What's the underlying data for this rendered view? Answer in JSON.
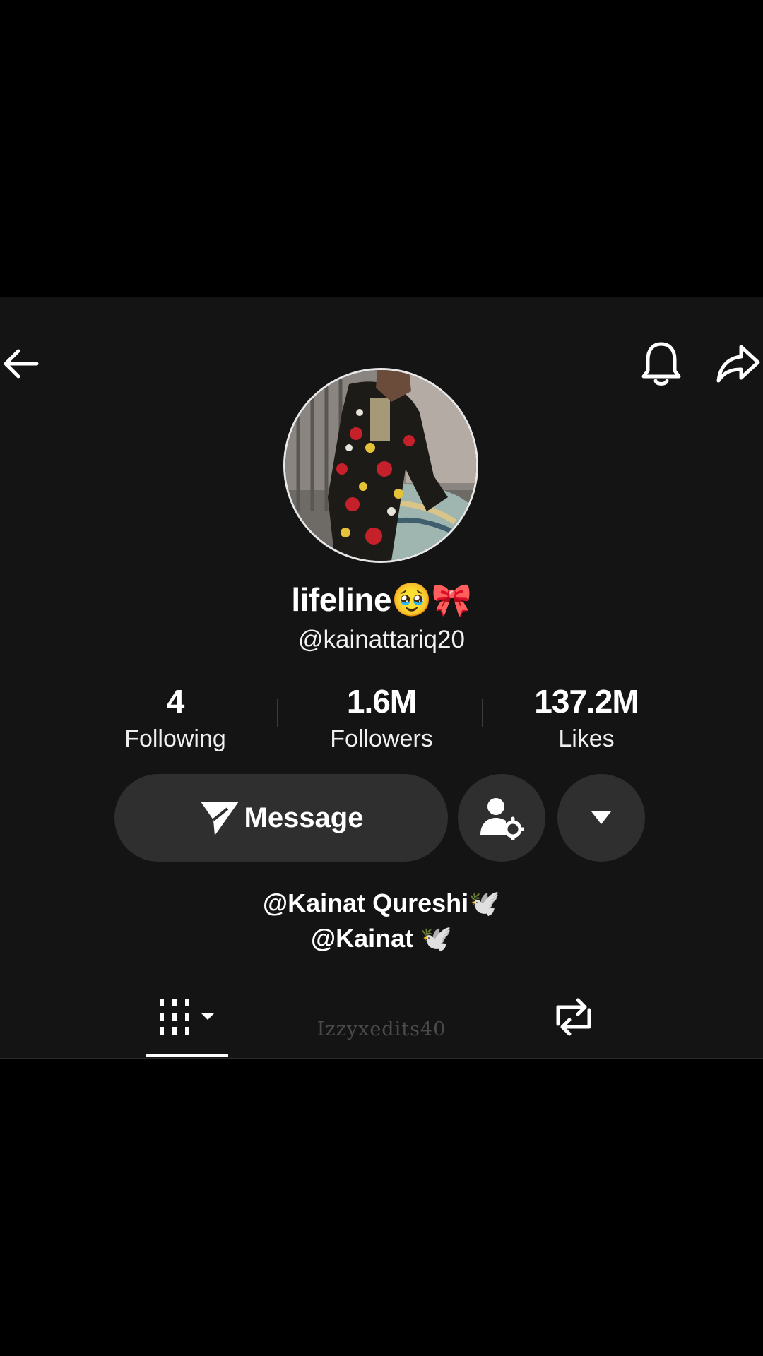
{
  "header": {
    "back_icon": "arrow-left-icon",
    "bell_icon": "bell-icon",
    "share_icon": "share-icon"
  },
  "profile": {
    "display_name": "lifeline🥹🎀",
    "username": "@kainattariq20",
    "avatar": "profile-photo"
  },
  "stats": [
    {
      "value": "4",
      "label": "Following"
    },
    {
      "value": "1.6M",
      "label": "Followers"
    },
    {
      "value": "137.2M",
      "label": "Likes"
    }
  ],
  "actions": {
    "message_label": "Message",
    "message_icon": "send-icon",
    "friends_icon": "user-settings-icon",
    "more_icon": "caret-down-icon"
  },
  "bio": {
    "line1": "@Kainat Qureshi🕊️",
    "line2": "@Kainat 🕊️"
  },
  "tabs": {
    "videos_icon": "grid-videos-icon",
    "reposts_icon": "repost-icon"
  },
  "watermark": "Izzyxedits40",
  "colors": {
    "background": "#000000",
    "panel": "#141414",
    "button": "#2f2f2f",
    "text": "#ffffff"
  }
}
